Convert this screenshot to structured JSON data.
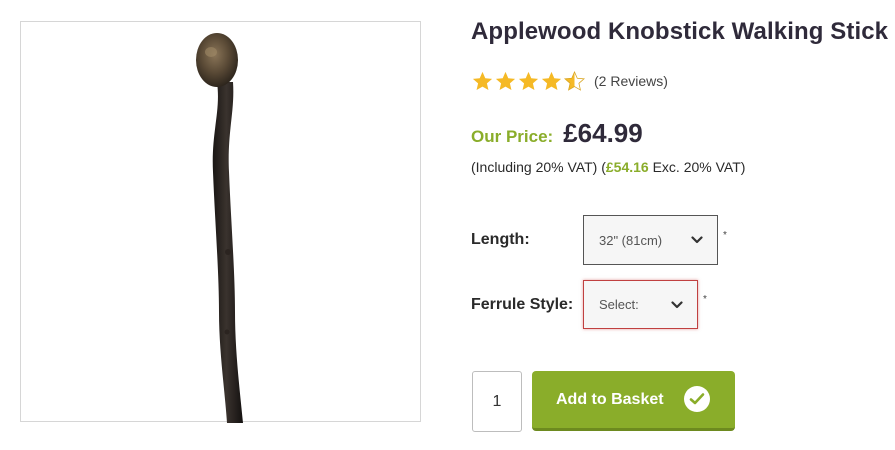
{
  "product": {
    "title": "Applewood Knobstick Walking Stick",
    "image_alt": "walking-stick-image",
    "rating": 4.5,
    "rating_max": 5,
    "reviews_text": "(2 Reviews)"
  },
  "price": {
    "label": "Our Price:",
    "value": "£64.99",
    "vat_prefix": "(Including 20% VAT) (",
    "ex_vat_value": "£54.16",
    "vat_suffix": " Exc. 20% VAT)"
  },
  "options": {
    "length": {
      "label": "Length:",
      "selected": "32\" (81cm)",
      "required_mark": "*"
    },
    "ferrule": {
      "label": "Ferrule Style:",
      "selected": "Select:",
      "required_mark": "*"
    }
  },
  "cart": {
    "quantity": "1",
    "add_label": "Add to Basket",
    "icon": "check-icon"
  },
  "colors": {
    "accent_green": "#8aad2a",
    "star_gold": "#f5b925",
    "error_red": "#c04040",
    "title_dark": "#2f2a3a"
  }
}
